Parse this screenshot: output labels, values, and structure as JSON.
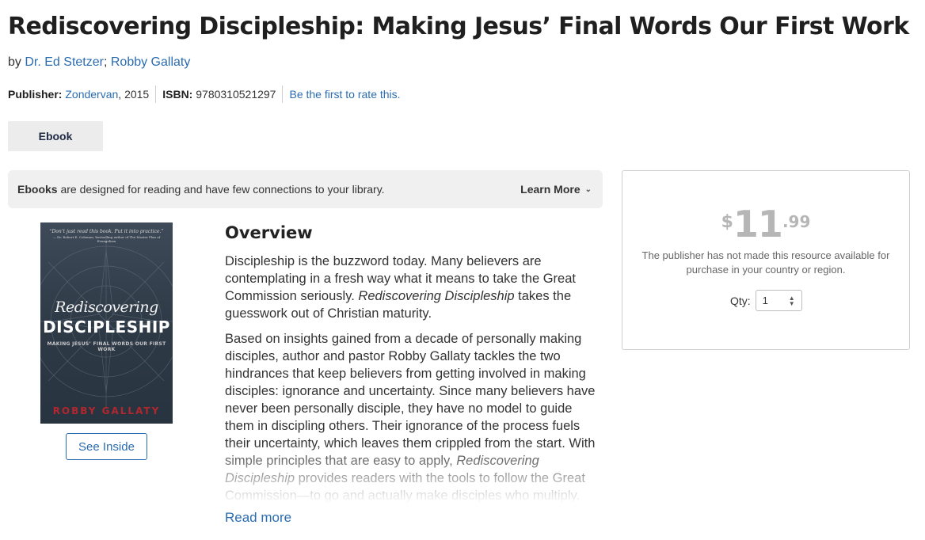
{
  "product": {
    "title": "Rediscovering Discipleship: Making Jesus’ Final Words Our First Work",
    "by_prefix": "by",
    "authors": [
      "Dr. Ed Stetzer",
      "Robby Gallaty"
    ],
    "author_separator": ";",
    "publisher_label": "Publisher:",
    "publisher": "Zondervan",
    "year": ", 2015",
    "isbn_label": "ISBN:",
    "isbn": "9780310521297",
    "rate_link": "Be the first to rate this."
  },
  "format": {
    "selected": "Ebook"
  },
  "info_bar": {
    "bold": "Ebooks",
    "text": " are designed for reading and have few connections to your library.",
    "learn_more": "Learn More",
    "learn_more_icon": "chevron-down-icon"
  },
  "cover": {
    "quote": "“Don’t just read this book. Put it into practice.”",
    "quote_attrib": "— Dr. Robert E. Coleman, bestselling author of The Master Plan of Evangelism",
    "title_script": "Rediscovering",
    "title_main": "DISCIPLESHIP",
    "tagline": "MAKING JESUS’ FINAL WORDS OUR FIRST WORK",
    "author": "ROBBY GALLATY",
    "see_inside": "See Inside"
  },
  "overview": {
    "heading": "Overview",
    "p1_a": "Discipleship is the buzzword today. Many believers are contemplating in a fresh way what it means to take the Great Commission seriously. ",
    "p1_em": "Rediscovering Discipleship",
    "p1_b": " takes the guesswork out of Christian maturity.",
    "p2_a": "Based on insights gained from a decade of personally making disciples, author and pastor Robby Gallaty tackles the two hindrances that keep believers from getting involved in making disciples: ignorance and uncertainty. Since many believers have never been personally disciple, they have no model to guide them in discipling others. Their ignorance of the process fuels their uncertainty, which leaves them crippled from the start. With simple principles that are easy to apply, ",
    "p2_em": "Rediscovering Discipleship",
    "p2_b": " provides readers with the tools to follow the Great Commission—to go and actually make disciples who multiply.",
    "read_more": "Read more"
  },
  "purchase": {
    "currency": "$",
    "price_whole": "11",
    "price_cents": ".99",
    "note": "The publisher has not made this resource available for purchase in your country or region.",
    "qty_label": "Qty:",
    "qty_value": "1",
    "qty_icon": "spinner-arrows-icon"
  },
  "colors": {
    "link": "#2b6cb0",
    "price_muted": "#b6b6b6",
    "cover_author": "#b3262e"
  }
}
